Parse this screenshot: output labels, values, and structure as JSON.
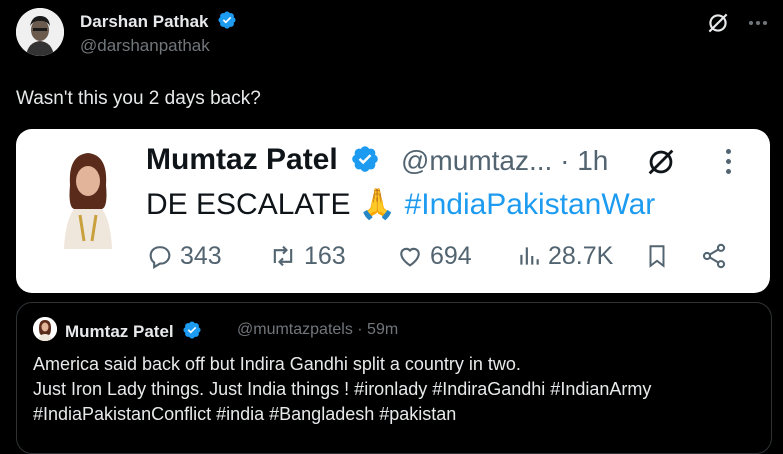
{
  "tweet": {
    "author_name": "Darshan Pathak",
    "author_handle": "@darshanpathak",
    "text": "Wasn't this you 2 days back?"
  },
  "screenshot_card": {
    "name": "Mumtaz Patel",
    "handle_time": "@mumtaz... · 1h",
    "text_prefix": "DE ESCALATE",
    "emoji": "🙏",
    "hashtag": "#IndiaPakistanWar",
    "actions": {
      "replies": "343",
      "reposts": "163",
      "likes": "694",
      "views": "28.7K"
    }
  },
  "quote": {
    "name": "Mumtaz Patel",
    "handle_time": "@mumtazpatels · 59m",
    "lines": [
      "America said back off but Indira Gandhi split a country in two.",
      "Just Iron Lady things. Just India things ! #ironlady #IndiraGandhi #IndianArmy",
      "#IndiaPakistanConflict #india #Bangladesh #pakistan"
    ]
  },
  "colors": {
    "background": "#000000",
    "text_primary": "#e7e9ea",
    "text_secondary": "#71767b",
    "verified": "#1d9bf0",
    "hashtag": "#1d9bf0",
    "card_bg": "#ffffff"
  },
  "icons": [
    "verified-badge-icon",
    "grok-icon",
    "more-icon",
    "reply-icon",
    "repost-icon",
    "like-icon",
    "views-icon",
    "bookmark-icon",
    "share-icon"
  ]
}
